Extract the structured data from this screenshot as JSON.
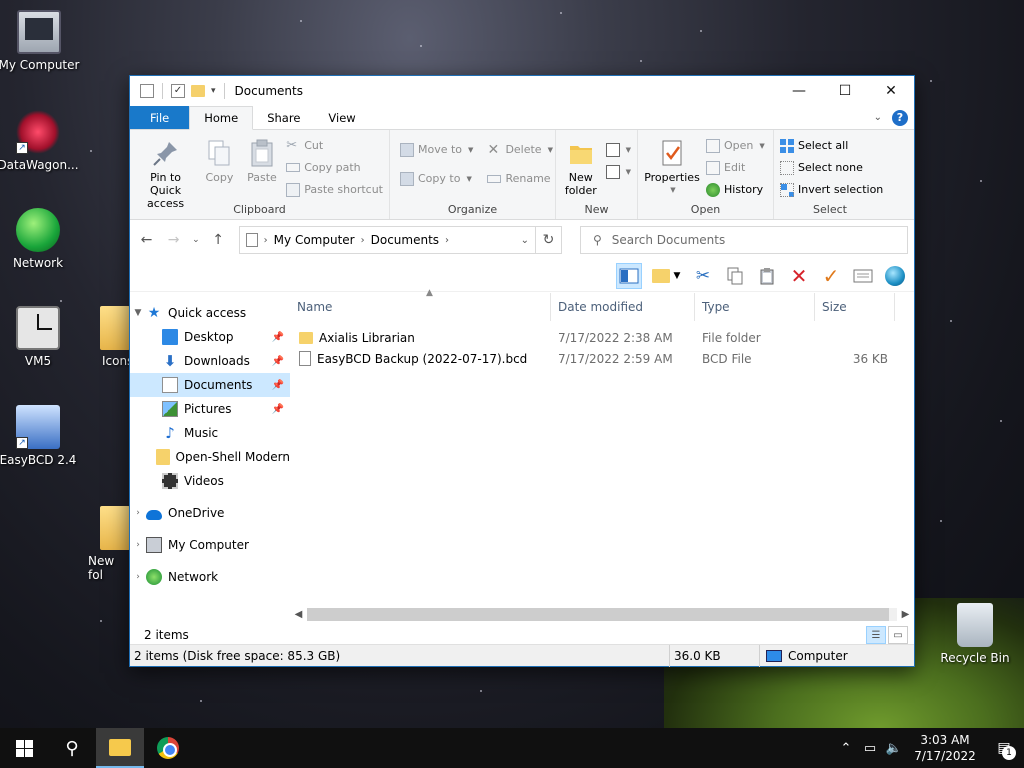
{
  "desktop": {
    "icons": [
      {
        "label": "My Computer"
      },
      {
        "label": "DataWagon..."
      },
      {
        "label": "Network"
      },
      {
        "label": "VM5"
      },
      {
        "label": "Icons"
      },
      {
        "label": "EasyBCD 2.4"
      },
      {
        "label": "New fol"
      },
      {
        "label": "Recycle Bin"
      }
    ]
  },
  "window": {
    "title": "Documents",
    "controls": {
      "minimize": "—",
      "maximize": "☐",
      "close": "✕"
    }
  },
  "ribbon": {
    "tabs": [
      "File",
      "Home",
      "Share",
      "View"
    ],
    "active_tab": "Home",
    "groups": {
      "clipboard": {
        "label": "Clipboard",
        "pin": "Pin to Quick access",
        "copy": "Copy",
        "paste": "Paste",
        "cut": "Cut",
        "copy_path": "Copy path",
        "paste_shortcut": "Paste shortcut"
      },
      "organize": {
        "label": "Organize",
        "move_to": "Move to",
        "copy_to": "Copy to",
        "delete": "Delete",
        "rename": "Rename"
      },
      "new": {
        "label": "New",
        "new_folder": "New folder"
      },
      "open": {
        "label": "Open",
        "properties": "Properties",
        "open": "Open",
        "edit": "Edit",
        "history": "History"
      },
      "select": {
        "label": "Select",
        "select_all": "Select all",
        "select_none": "Select none",
        "invert": "Invert selection"
      }
    }
  },
  "address": {
    "crumbs": [
      "My Computer",
      "Documents"
    ],
    "search_placeholder": "Search Documents"
  },
  "nav": {
    "quick_access": "Quick access",
    "items": [
      {
        "label": "Desktop",
        "pinned": true
      },
      {
        "label": "Downloads",
        "pinned": true
      },
      {
        "label": "Documents",
        "pinned": true
      },
      {
        "label": "Pictures",
        "pinned": true
      },
      {
        "label": "Music",
        "pinned": false
      },
      {
        "label": "Open-Shell Modern",
        "pinned": false
      },
      {
        "label": "Videos",
        "pinned": false
      }
    ],
    "onedrive": "OneDrive",
    "my_computer": "My Computer",
    "network": "Network"
  },
  "files": {
    "columns": {
      "name": "Name",
      "date": "Date modified",
      "type": "Type",
      "size": "Size"
    },
    "rows": [
      {
        "name": "Axialis Librarian",
        "date": "7/17/2022 2:38 AM",
        "type": "File folder",
        "size": ""
      },
      {
        "name": "EasyBCD Backup (2022-07-17).bcd",
        "date": "7/17/2022 2:59 AM",
        "type": "BCD File",
        "size": "36 KB"
      }
    ]
  },
  "status": {
    "count": "2 items",
    "info": "2 items (Disk free space: 85.3 GB)",
    "size": "36.0 KB",
    "location": "Computer"
  },
  "taskbar": {
    "time": "3:03 AM",
    "date": "7/17/2022",
    "notifications": "1"
  },
  "colors": {
    "accent": "#1979ca",
    "selection": "#cce8ff",
    "delete_red": "#d6232b",
    "check_orange": "#e07a1c"
  }
}
